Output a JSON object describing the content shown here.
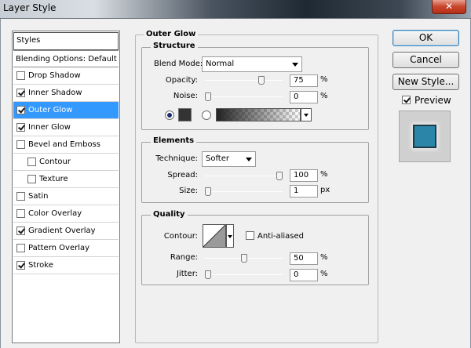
{
  "window": {
    "title": "Layer Style",
    "close_glyph": "✕"
  },
  "styles_panel": {
    "header": "Styles",
    "blending_options": "Blending Options: Default",
    "items": [
      {
        "label": "Drop Shadow",
        "checked": false
      },
      {
        "label": "Inner Shadow",
        "checked": true
      },
      {
        "label": "Outer Glow",
        "checked": true,
        "selected": true
      },
      {
        "label": "Inner Glow",
        "checked": true
      },
      {
        "label": "Bevel and Emboss",
        "checked": false
      },
      {
        "label": "Contour",
        "checked": false,
        "indent": true
      },
      {
        "label": "Texture",
        "checked": false,
        "indent": true
      },
      {
        "label": "Satin",
        "checked": false
      },
      {
        "label": "Color Overlay",
        "checked": false
      },
      {
        "label": "Gradient Overlay",
        "checked": true
      },
      {
        "label": "Pattern Overlay",
        "checked": false
      },
      {
        "label": "Stroke",
        "checked": true
      }
    ]
  },
  "outer_glow": {
    "title": "Outer Glow",
    "structure": {
      "title": "Structure",
      "blend_mode_label": "Blend Mode:",
      "blend_mode_value": "Normal",
      "opacity_label": "Opacity:",
      "opacity_value": "75",
      "opacity_level": 0.75,
      "noise_label": "Noise:",
      "noise_value": "0",
      "noise_level": 0,
      "unit_percent": "%",
      "color_swatch": "#333333"
    },
    "elements": {
      "title": "Elements",
      "technique_label": "Technique:",
      "technique_value": "Softer",
      "spread_label": "Spread:",
      "spread_value": "100",
      "spread_level": 1.0,
      "size_label": "Size:",
      "size_value": "1",
      "size_level": 0.0,
      "unit_percent": "%",
      "unit_px": "px"
    },
    "quality": {
      "title": "Quality",
      "contour_label": "Contour:",
      "anti_aliased_label": "Anti-aliased",
      "anti_aliased": false,
      "range_label": "Range:",
      "range_value": "50",
      "range_level": 0.5,
      "jitter_label": "Jitter:",
      "jitter_value": "0",
      "jitter_level": 0,
      "unit_percent": "%"
    }
  },
  "buttons": {
    "ok": "OK",
    "cancel": "Cancel",
    "new_style": "New Style...",
    "preview_label": "Preview",
    "preview_checked": true
  },
  "colors": {
    "selection": "#3399ff",
    "preview_fill": "#2b85a8",
    "preview_border": "#1d3a46"
  }
}
